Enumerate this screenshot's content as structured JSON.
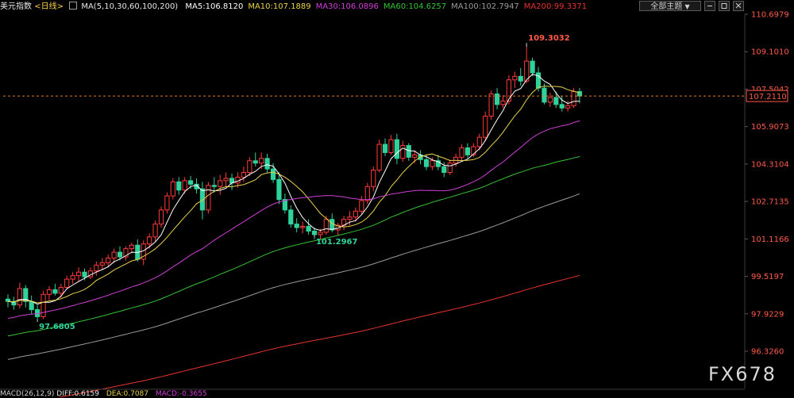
{
  "header": {
    "title": "美元指数",
    "period": "<日线>",
    "ma_spec": "MA(5,10,30,60,100,200)",
    "ma_values": [
      {
        "label": "MA5:106.8120",
        "color": "#ffffff"
      },
      {
        "label": "MA10:107.1889",
        "color": "#e8d24a"
      },
      {
        "label": "MA30:106.0896",
        "color": "#d13fd6"
      },
      {
        "label": "MA60:104.6257",
        "color": "#34c234"
      },
      {
        "label": "MA100:102.7947",
        "color": "#9a9a9a"
      },
      {
        "label": "MA200:99.3371",
        "color": "#e8332e"
      }
    ],
    "theme_button": "全部主题",
    "theme_arrow": "▼"
  },
  "price_axis": {
    "ticks": [
      "110.6979",
      "109.1010",
      "107.5042",
      "105.9073",
      "104.3104",
      "102.7135",
      "101.1166",
      "99.5197",
      "97.9229",
      "96.3260"
    ],
    "current_price": "107.2110"
  },
  "annotations": {
    "high": "109.3032",
    "low": "97.6805",
    "mid_low": "101.2967"
  },
  "macd_header": {
    "label": "MACD(26,12,9)",
    "diff": "DIFF:0.6159",
    "dea": "DEA:0.7087",
    "macd": "MACD:-0.3655"
  },
  "watermark": "FX678",
  "colors": {
    "up": "#ff3b3b",
    "down": "#2fd29a",
    "background": "#000000",
    "axis_text": "#c8c8c8",
    "price_text": "#ff5a4a"
  },
  "chart_data": {
    "type": "candlestick",
    "title": "美元指数 <日线>",
    "ylim": [
      96.326,
      110.6979
    ],
    "candles": [
      [
        98.55,
        98.75,
        98.2,
        98.45
      ],
      [
        98.45,
        98.65,
        98.1,
        98.3
      ],
      [
        98.3,
        99.25,
        98.15,
        99.0
      ],
      [
        99.0,
        99.15,
        98.2,
        98.45
      ],
      [
        98.45,
        98.7,
        97.9,
        98.1
      ],
      [
        98.1,
        98.3,
        97.68,
        97.8
      ],
      [
        97.8,
        98.9,
        97.7,
        98.75
      ],
      [
        98.75,
        99.1,
        98.5,
        98.95
      ],
      [
        98.95,
        99.2,
        98.7,
        98.8
      ],
      [
        98.8,
        99.2,
        98.6,
        99.05
      ],
      [
        99.05,
        99.55,
        98.95,
        99.4
      ],
      [
        99.4,
        99.7,
        99.2,
        99.55
      ],
      [
        99.55,
        99.9,
        99.3,
        99.7
      ],
      [
        99.7,
        99.85,
        99.35,
        99.5
      ],
      [
        99.5,
        99.9,
        99.4,
        99.75
      ],
      [
        99.75,
        100.15,
        99.55,
        100.0
      ],
      [
        100.0,
        100.3,
        99.8,
        100.1
      ],
      [
        100.1,
        100.45,
        99.9,
        100.3
      ],
      [
        100.3,
        100.7,
        100.1,
        100.55
      ],
      [
        100.55,
        100.8,
        100.2,
        100.35
      ],
      [
        100.35,
        100.8,
        100.2,
        100.7
      ],
      [
        100.7,
        100.95,
        100.5,
        100.85
      ],
      [
        100.85,
        101.1,
        100.15,
        100.25
      ],
      [
        100.25,
        101.05,
        100.0,
        100.9
      ],
      [
        100.9,
        101.35,
        100.7,
        101.2
      ],
      [
        101.2,
        101.9,
        101.0,
        101.75
      ],
      [
        101.75,
        102.5,
        101.6,
        102.35
      ],
      [
        102.35,
        103.1,
        102.2,
        102.95
      ],
      [
        102.95,
        103.7,
        102.8,
        103.55
      ],
      [
        103.55,
        103.75,
        103.0,
        103.2
      ],
      [
        103.2,
        103.75,
        103.05,
        103.6
      ],
      [
        103.6,
        103.8,
        103.25,
        103.45
      ],
      [
        103.45,
        103.7,
        103.05,
        103.25
      ],
      [
        103.25,
        103.55,
        101.95,
        102.35
      ],
      [
        102.35,
        103.55,
        102.2,
        103.4
      ],
      [
        103.4,
        103.75,
        103.1,
        103.35
      ],
      [
        103.35,
        103.85,
        103.0,
        103.6
      ],
      [
        103.6,
        103.95,
        103.35,
        103.7
      ],
      [
        103.7,
        103.9,
        103.2,
        103.5
      ],
      [
        103.5,
        103.95,
        103.3,
        103.75
      ],
      [
        103.75,
        104.2,
        103.55,
        103.95
      ],
      [
        103.95,
        104.6,
        103.8,
        104.45
      ],
      [
        104.45,
        104.8,
        104.2,
        104.35
      ],
      [
        104.35,
        104.8,
        104.1,
        104.55
      ],
      [
        104.55,
        104.75,
        103.95,
        104.1
      ],
      [
        104.1,
        104.35,
        103.5,
        103.65
      ],
      [
        103.65,
        103.95,
        102.6,
        102.8
      ],
      [
        102.8,
        103.05,
        102.2,
        102.35
      ],
      [
        102.35,
        102.55,
        101.6,
        101.75
      ],
      [
        101.75,
        102.0,
        101.4,
        101.6
      ],
      [
        101.6,
        101.85,
        101.35,
        101.65
      ],
      [
        101.65,
        101.95,
        101.3,
        101.45
      ],
      [
        101.45,
        101.6,
        101.1,
        101.3
      ],
      [
        101.3,
        101.55,
        101.05,
        101.4
      ],
      [
        101.4,
        102.1,
        101.3,
        101.95
      ],
      [
        101.95,
        102.2,
        101.4,
        101.5
      ],
      [
        101.5,
        101.8,
        101.25,
        101.7
      ],
      [
        101.7,
        102.1,
        101.5,
        101.95
      ],
      [
        101.95,
        102.3,
        101.7,
        102.05
      ],
      [
        102.05,
        102.45,
        101.85,
        102.3
      ],
      [
        102.3,
        102.95,
        102.15,
        102.75
      ],
      [
        102.75,
        103.5,
        102.6,
        103.35
      ],
      [
        103.35,
        104.2,
        103.15,
        104.05
      ],
      [
        104.05,
        105.35,
        103.95,
        105.15
      ],
      [
        105.15,
        105.4,
        104.65,
        104.8
      ],
      [
        104.8,
        105.55,
        104.7,
        105.35
      ],
      [
        105.35,
        105.6,
        104.3,
        104.55
      ],
      [
        104.55,
        105.3,
        104.4,
        105.1
      ],
      [
        105.1,
        105.2,
        104.45,
        104.6
      ],
      [
        104.6,
        104.9,
        104.35,
        104.7
      ],
      [
        104.7,
        104.9,
        104.3,
        104.5
      ],
      [
        104.5,
        104.7,
        104.05,
        104.2
      ],
      [
        104.2,
        104.6,
        104.05,
        104.45
      ],
      [
        104.45,
        104.7,
        104.05,
        104.2
      ],
      [
        104.2,
        104.4,
        103.75,
        103.95
      ],
      [
        103.95,
        104.5,
        103.85,
        104.35
      ],
      [
        104.35,
        104.75,
        104.2,
        104.6
      ],
      [
        104.6,
        105.15,
        104.45,
        105.0
      ],
      [
        105.0,
        105.2,
        104.55,
        104.7
      ],
      [
        104.7,
        105.2,
        104.6,
        105.05
      ],
      [
        105.05,
        105.6,
        104.9,
        105.45
      ],
      [
        105.45,
        106.55,
        105.3,
        106.35
      ],
      [
        106.35,
        107.45,
        106.2,
        107.3
      ],
      [
        107.3,
        107.55,
        106.65,
        106.85
      ],
      [
        106.85,
        107.25,
        106.7,
        107.0
      ],
      [
        107.0,
        108.1,
        106.85,
        107.9
      ],
      [
        107.9,
        108.25,
        107.55,
        108.05
      ],
      [
        108.05,
        108.4,
        107.65,
        107.85
      ],
      [
        107.85,
        109.3,
        107.75,
        108.7
      ],
      [
        108.7,
        108.85,
        108.05,
        108.2
      ],
      [
        108.2,
        108.45,
        107.4,
        107.55
      ],
      [
        107.55,
        107.75,
        106.85,
        106.95
      ],
      [
        106.95,
        107.35,
        106.75,
        107.15
      ],
      [
        107.15,
        107.4,
        106.7,
        106.85
      ],
      [
        106.85,
        107.2,
        106.55,
        106.7
      ],
      [
        106.7,
        107.0,
        106.55,
        106.8
      ],
      [
        106.8,
        107.55,
        106.7,
        107.4
      ],
      [
        107.4,
        107.55,
        106.9,
        107.21
      ]
    ],
    "marks": [
      {
        "label": "109.3032",
        "index": 88,
        "value": 109.3032,
        "pos": "above"
      },
      {
        "label": "97.6805",
        "index": 5,
        "value": 97.6805,
        "pos": "below"
      },
      {
        "label": "101.2967",
        "index": 52,
        "value": 101.2967,
        "pos": "below"
      }
    ]
  }
}
